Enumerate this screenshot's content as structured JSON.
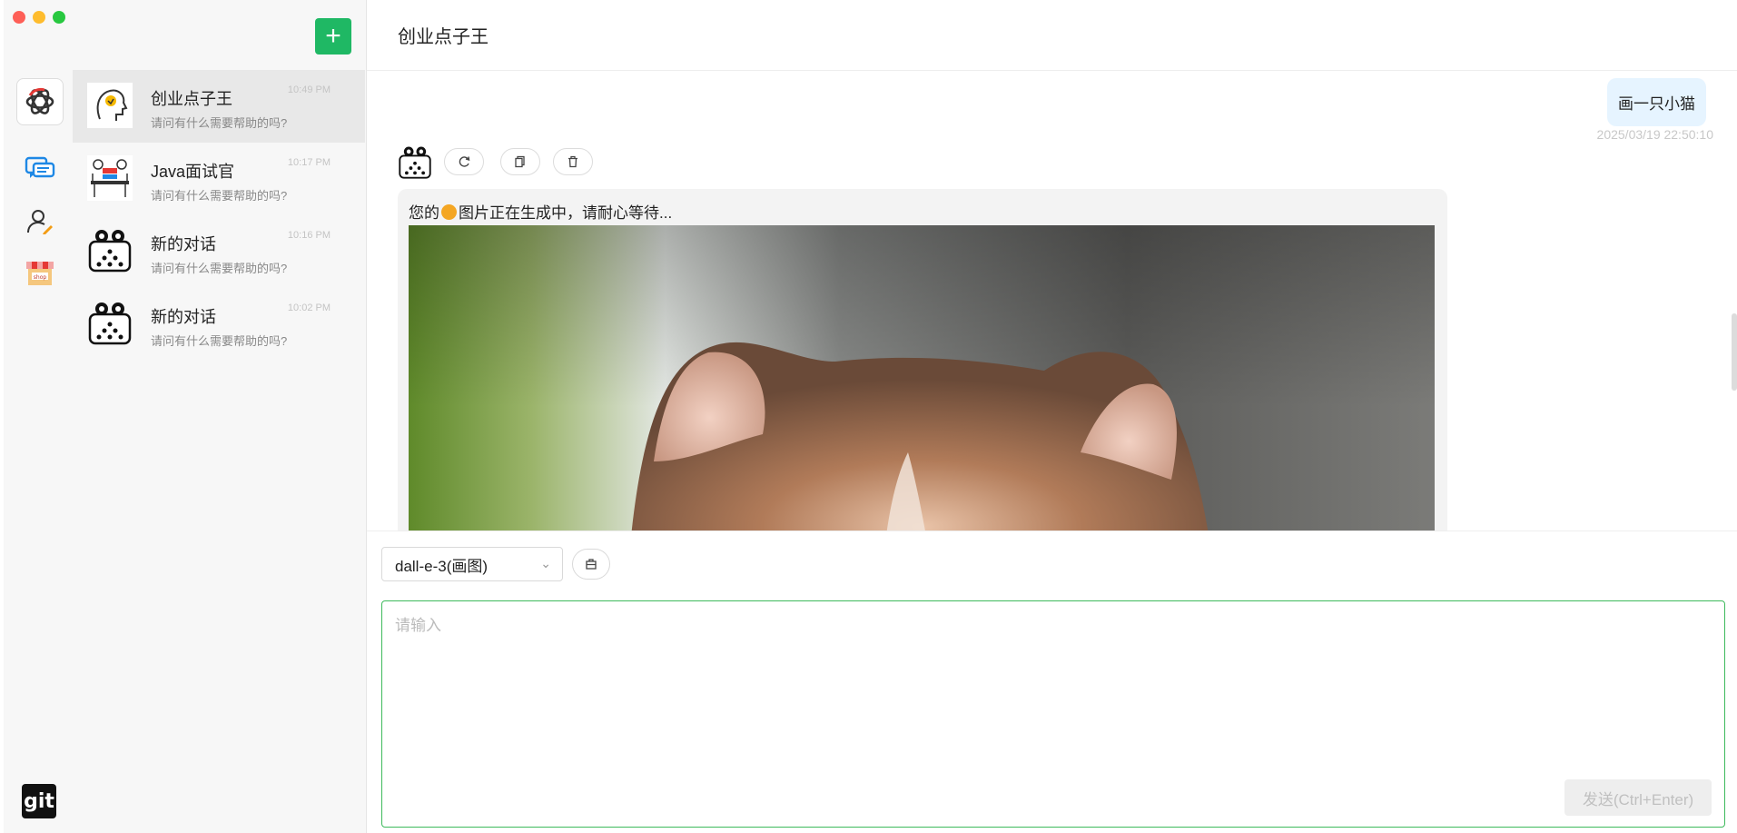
{
  "window": {
    "traffic_lights": [
      "close",
      "minimize",
      "maximize"
    ]
  },
  "rail": {
    "items": [
      {
        "icon": "chat-bubbles-icon",
        "active": true
      },
      {
        "icon": "user-edit-icon",
        "active": false
      },
      {
        "icon": "shop-icon",
        "active": false
      }
    ],
    "git_label": "git"
  },
  "conversations": {
    "new_button_label": "+",
    "items": [
      {
        "title": "创业点子王",
        "preview": "请问有什么需要帮助的吗?",
        "time": "10:49 PM",
        "avatar": "head-idea-avatar",
        "active": true
      },
      {
        "title": "Java面试官",
        "preview": "请问有什么需要帮助的吗?",
        "time": "10:17 PM",
        "avatar": "interview-avatar",
        "active": false
      },
      {
        "title": "新的对话",
        "preview": "请问有什么需要帮助的吗?",
        "time": "10:16 PM",
        "avatar": "robot-avatar",
        "active": false
      },
      {
        "title": "新的对话",
        "preview": "请问有什么需要帮助的吗?",
        "time": "10:02 PM",
        "avatar": "robot-avatar",
        "active": false
      }
    ]
  },
  "chat": {
    "title": "创业点子王",
    "user_message": {
      "text": "画一只小猫",
      "time": "2025/03/19 22:50:10"
    },
    "bot_message": {
      "text_before": "您的",
      "text_after": "图片正在生成中，请耐心等待...",
      "tools": [
        "refresh-icon",
        "copy-icon",
        "delete-icon"
      ]
    }
  },
  "input": {
    "model": "dall-e-3(画图)",
    "placeholder": "请输入",
    "send_label": "发送(Ctrl+Enter)"
  },
  "colors": {
    "accent": "#1fb864",
    "user_bubble": "#e6f4ff",
    "input_border": "#3dba5c"
  }
}
